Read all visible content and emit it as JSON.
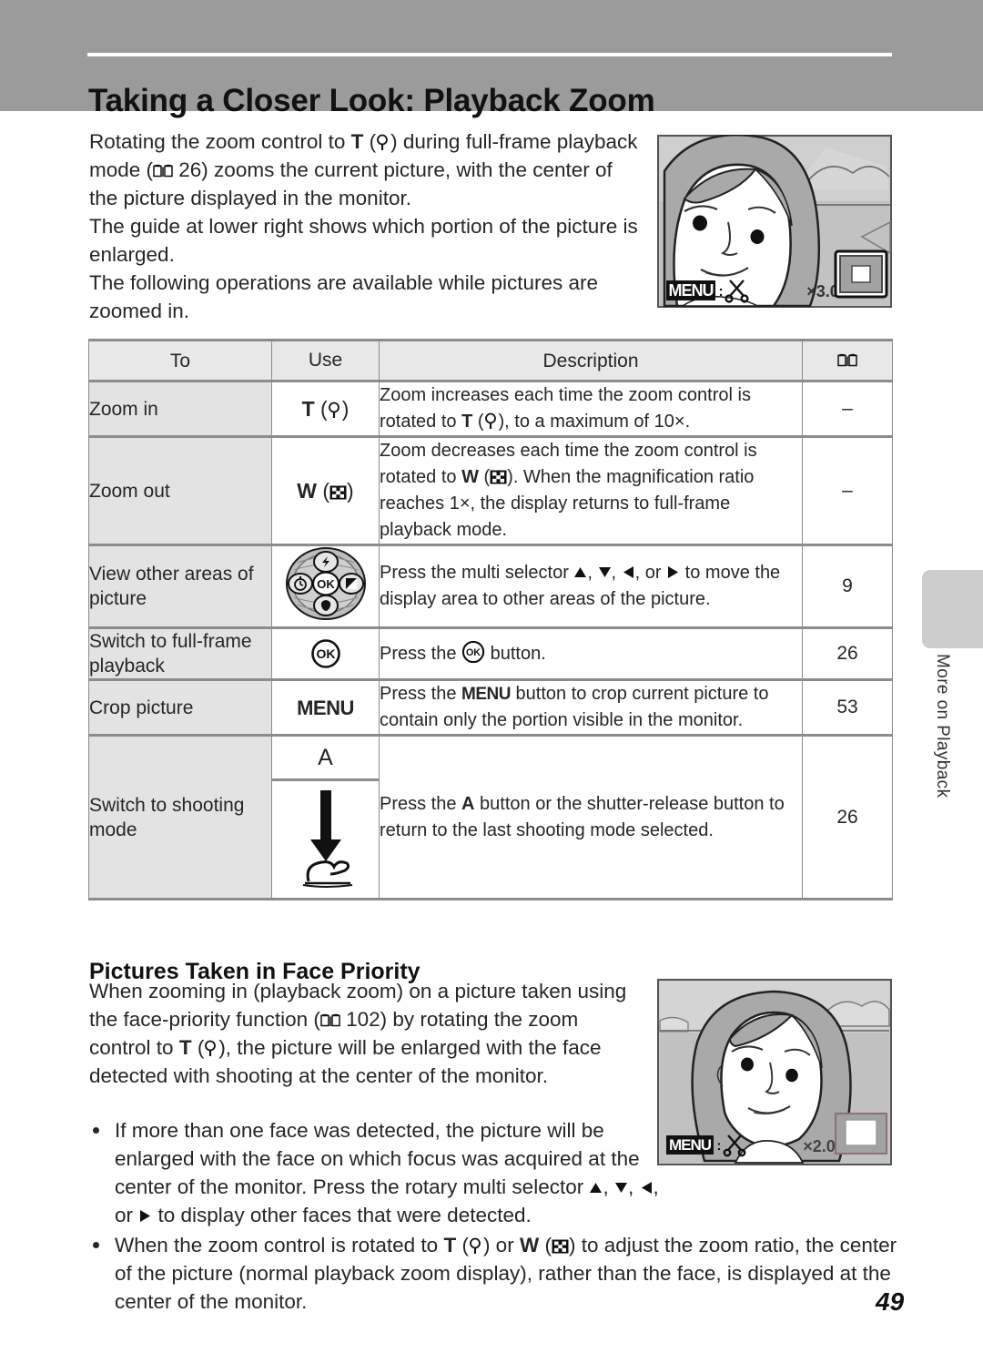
{
  "header": {
    "title": "Taking a Closer Look: Playback Zoom"
  },
  "intro": {
    "p1_a": "Rotating the zoom control to ",
    "p1_T": "T",
    "p1_b": " (",
    "p1_c": ") during full-frame playback mode (",
    "p1_d": " 26) zooms the current picture, with the center of the picture displayed in the monitor.",
    "p2": "The guide at lower right shows which portion of the picture is enlarged.",
    "p3": "The following operations are available while pictures are zoomed in."
  },
  "screens": {
    "top": {
      "menu_label": "MENU",
      "menu_sep": ":",
      "zoom_label": "×3.0"
    },
    "bottom": {
      "menu_label": "MENU",
      "menu_sep": ":",
      "zoom_label": "×2.0"
    }
  },
  "table": {
    "headers": {
      "to": "To",
      "use": "Use",
      "description": "Description",
      "page": "book-icon"
    },
    "rows": [
      {
        "to": "Zoom in",
        "use_T": "T",
        "use_paren_open": "(",
        "use_paren_close": ")",
        "desc_a": "Zoom increases each time the zoom control is rotated to ",
        "desc_T": "T",
        "desc_b": " (",
        "desc_c": "), to a maximum of 10×.",
        "page": "–"
      },
      {
        "to": "Zoom out",
        "use_W": "W",
        "use_paren_open": "(",
        "use_paren_close": ")",
        "desc_a": "Zoom decreases each time the zoom control is rotated to ",
        "desc_W": "W",
        "desc_b": " (",
        "desc_c": "). When the magnification ratio reaches 1×, the display returns to full-frame playback mode.",
        "page": "–"
      },
      {
        "to": "View other areas of picture",
        "use_icon": "rotary-multi-selector-icon",
        "desc_a": "Press the multi selector ",
        "desc_b": ", ",
        "desc_c": ", ",
        "desc_d": ", or ",
        "desc_e": " to move the display area to other areas of the picture.",
        "page": "9"
      },
      {
        "to": "Switch to full-frame playback",
        "use_icon": "ok-button-icon",
        "desc_a": "Press the ",
        "desc_b": " button.",
        "page": "26"
      },
      {
        "to": "Crop picture",
        "use_label": "MENU",
        "desc_a": "Press the ",
        "desc_menu": "MENU",
        "desc_b": " button to crop current picture to contain only the portion visible in the monitor.",
        "page": "53"
      },
      {
        "to": "Switch to shooting mode",
        "use_label_a": "A",
        "use_icon": "shutter-release-icon",
        "desc_a": "Press the ",
        "desc_A": "A",
        "desc_b": " button or the shutter-release button to return to the last shooting mode selected.",
        "page": "26"
      }
    ]
  },
  "face_section": {
    "heading": "Pictures Taken in Face Priority",
    "para_a": "When zooming in (playback zoom) on a picture taken using the face-priority function (",
    "para_b": " 102) by rotating the zoom control to ",
    "para_T": "T",
    "para_c": " (",
    "para_d": "), the picture will be enlarged with the face detected with shooting at the center of the monitor.",
    "bullets": [
      {
        "t_a": "If more than one face was detected, the picture will be enlarged with the face on which focus was acquired at the center of the monitor. Press the rotary multi selector ",
        "t_b": ", ",
        "t_c": ", ",
        "t_d": ", or ",
        "t_e": " to display other faces that were detected."
      },
      {
        "t_a": "When the zoom control is rotated to ",
        "t_T": "T",
        "t_b": " (",
        "t_c": ") or ",
        "t_W": "W",
        "t_d": " (",
        "t_e": ") to adjust the zoom ratio, the center of the picture (normal playback zoom display), rather than the face, is displayed at the center of the monitor."
      }
    ]
  },
  "side_tab": {
    "label": "More on Playback"
  },
  "page_number": "49",
  "colors": {
    "header_band": "#9b9b9b",
    "table_header_bg": "#e8e8e8",
    "table_first_col_bg": "#e3e3e3",
    "side_swatch": "#cdcdcd"
  }
}
